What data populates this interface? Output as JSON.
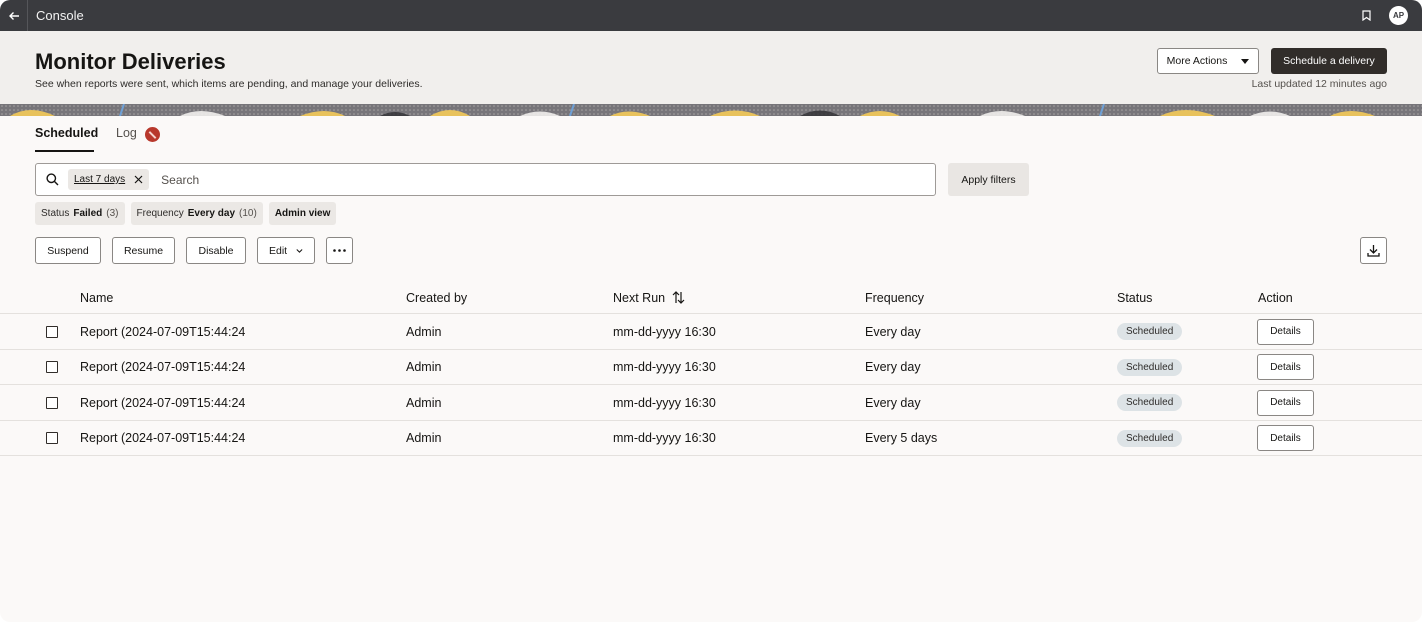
{
  "topbar": {
    "back_icon": "arrow-left-icon",
    "app_title": "Console",
    "avatar_initials": "AP"
  },
  "header": {
    "title": "Monitor Deliveries",
    "subtitle": "See when reports were sent, which items are pending, and manage your deliveries.",
    "more_actions_label": "More Actions",
    "schedule_label": "Schedule a delivery",
    "last_updated": "Last updated 12 minutes ago"
  },
  "tabs": [
    {
      "label": "Scheduled",
      "active": true
    },
    {
      "label": "Log",
      "active": false
    }
  ],
  "search": {
    "chip_label": "Last 7 days",
    "placeholder": "Search",
    "value": "",
    "apply_label": "Apply filters"
  },
  "filters": [
    {
      "key": "Status",
      "value": "Failed",
      "count": "(3)"
    },
    {
      "key": "Frequency",
      "value": "Every day",
      "count": "(10)"
    },
    {
      "key": "",
      "value": "Admin view",
      "count": ""
    }
  ],
  "toolbar": {
    "suspend_label": "Suspend",
    "resume_label": "Resume",
    "disable_label": "Disable",
    "edit_label": "Edit",
    "more_icon": "ellipsis-icon",
    "download_icon": "download-icon"
  },
  "table": {
    "columns": [
      "Name",
      "Created by",
      "Next Run",
      "Frequency",
      "Status",
      "Action"
    ],
    "rows": [
      {
        "name": "Report (2024-07-09T15:44:24",
        "created_by": "Admin",
        "next_run": "mm-dd-yyyy 16:30",
        "frequency": "Every day",
        "status": "Scheduled",
        "action": "Details"
      },
      {
        "name": "Report (2024-07-09T15:44:24",
        "created_by": "Admin",
        "next_run": "mm-dd-yyyy 16:30",
        "frequency": "Every day",
        "status": "Scheduled",
        "action": "Details"
      },
      {
        "name": "Report (2024-07-09T15:44:24",
        "created_by": "Admin",
        "next_run": "mm-dd-yyyy 16:30",
        "frequency": "Every day",
        "status": "Scheduled",
        "action": "Details"
      },
      {
        "name": "Report (2024-07-09T15:44:24",
        "created_by": "Admin",
        "next_run": "mm-dd-yyyy 16:30",
        "frequency": "Every 5 days",
        "status": "Scheduled",
        "action": "Details"
      }
    ]
  },
  "colors": {
    "topbar": "#3a3b3f",
    "primary_button": "#312d2a",
    "log_badge": "#b8382c",
    "status_badge": "#dde3e6"
  }
}
